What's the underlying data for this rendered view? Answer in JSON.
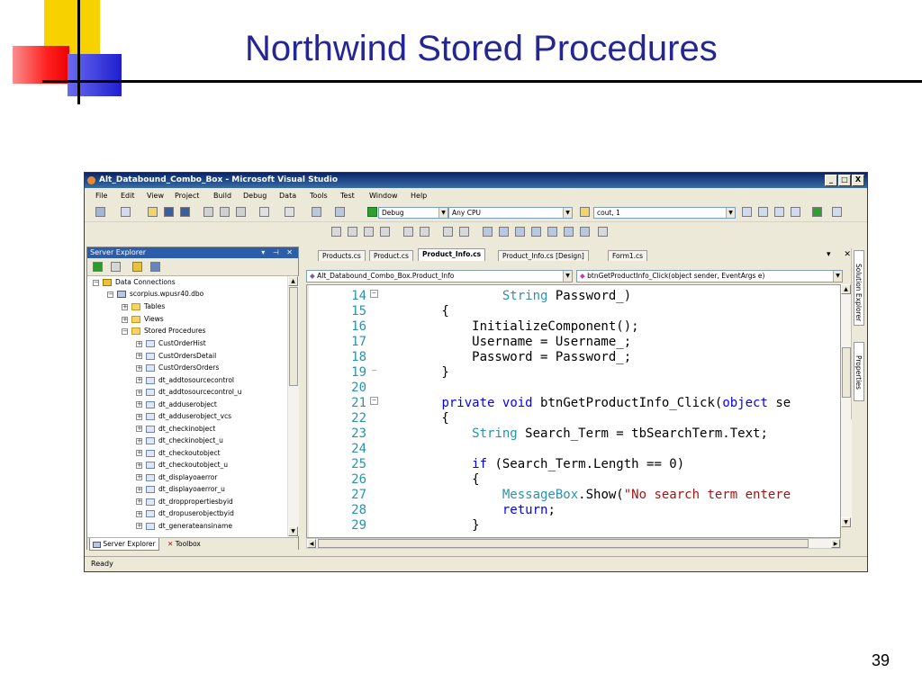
{
  "slide": {
    "title": "Northwind Stored Procedures",
    "number": "39"
  },
  "window": {
    "title": "Alt_Databound_Combo_Box - Microsoft Visual Studio",
    "buttons": [
      "_",
      "□",
      "X"
    ]
  },
  "menu": [
    "File",
    "Edit",
    "View",
    "Project",
    "Build",
    "Debug",
    "Data",
    "Tools",
    "Test",
    "Window",
    "Help"
  ],
  "toolbar": {
    "configuration": "Debug",
    "platform": "Any CPU",
    "find_text": "cout, 1"
  },
  "server_explorer": {
    "title": "Server Explorer",
    "controls": "▾ ⊣ ✕",
    "tree": {
      "root": "Data Connections",
      "connection": "scorpius.wpusr40.dbo",
      "tables": "Tables",
      "views": "Views",
      "stored_procedures": "Stored Procedures",
      "procedures": [
        "CustOrderHist",
        "CustOrdersDetail",
        "CustOrdersOrders",
        "dt_addtosourcecontrol",
        "dt_addtosourcecontrol_u",
        "dt_adduserobject",
        "dt_adduserobject_vcs",
        "dt_checkinobject",
        "dt_checkinobject_u",
        "dt_checkoutobject",
        "dt_checkoutobject_u",
        "dt_displayoaerror",
        "dt_displayoaerror_u",
        "dt_droppropertiesbyid",
        "dt_dropuserobjectbyid",
        "dt_generateansiname"
      ]
    },
    "bottom_tabs": [
      "Server Explorer",
      "Toolbox"
    ]
  },
  "documents": {
    "tabs": [
      "Products.cs",
      "Product.cs",
      "Product_Info.cs",
      "Product_Info.cs [Design]",
      "Form1.cs"
    ],
    "active_tab": "Product_Info.cs",
    "controls": "▾ ✕",
    "class_dropdown": "Alt_Databound_Combo_Box.Product_Info",
    "member_dropdown": "btnGetProductInfo_Click(object sender, EventArgs e)"
  },
  "code_lines": [
    {
      "ln": "14",
      "text": "                String Password_)"
    },
    {
      "ln": "15",
      "text": "        {"
    },
    {
      "ln": "16",
      "text": "            InitializeComponent();"
    },
    {
      "ln": "17",
      "text": "            Username = Username_;"
    },
    {
      "ln": "18",
      "text": "            Password = Password_;"
    },
    {
      "ln": "19",
      "text": "        }"
    },
    {
      "ln": "20",
      "text": ""
    },
    {
      "ln": "21",
      "text": "        private void btnGetProductInfo_Click(object se"
    },
    {
      "ln": "22",
      "text": "        {"
    },
    {
      "ln": "23",
      "text": "            String Search_Term = tbSearchTerm.Text;"
    },
    {
      "ln": "24",
      "text": ""
    },
    {
      "ln": "25",
      "text": "            if (Search_Term.Length == 0)"
    },
    {
      "ln": "26",
      "text": "            {"
    },
    {
      "ln": "27",
      "text": "                MessageBox.Show(\"No search term entere"
    },
    {
      "ln": "28",
      "text": "                return;"
    },
    {
      "ln": "29",
      "text": "            }"
    }
  ],
  "side_tabs": [
    "Solution Explorer",
    "Properties"
  ],
  "status": "Ready",
  "colors": {
    "title_text": "#262693",
    "keyword": "#0000ff",
    "type": "#2b91af",
    "string": "#a31515",
    "line_number": "#2b91af"
  }
}
